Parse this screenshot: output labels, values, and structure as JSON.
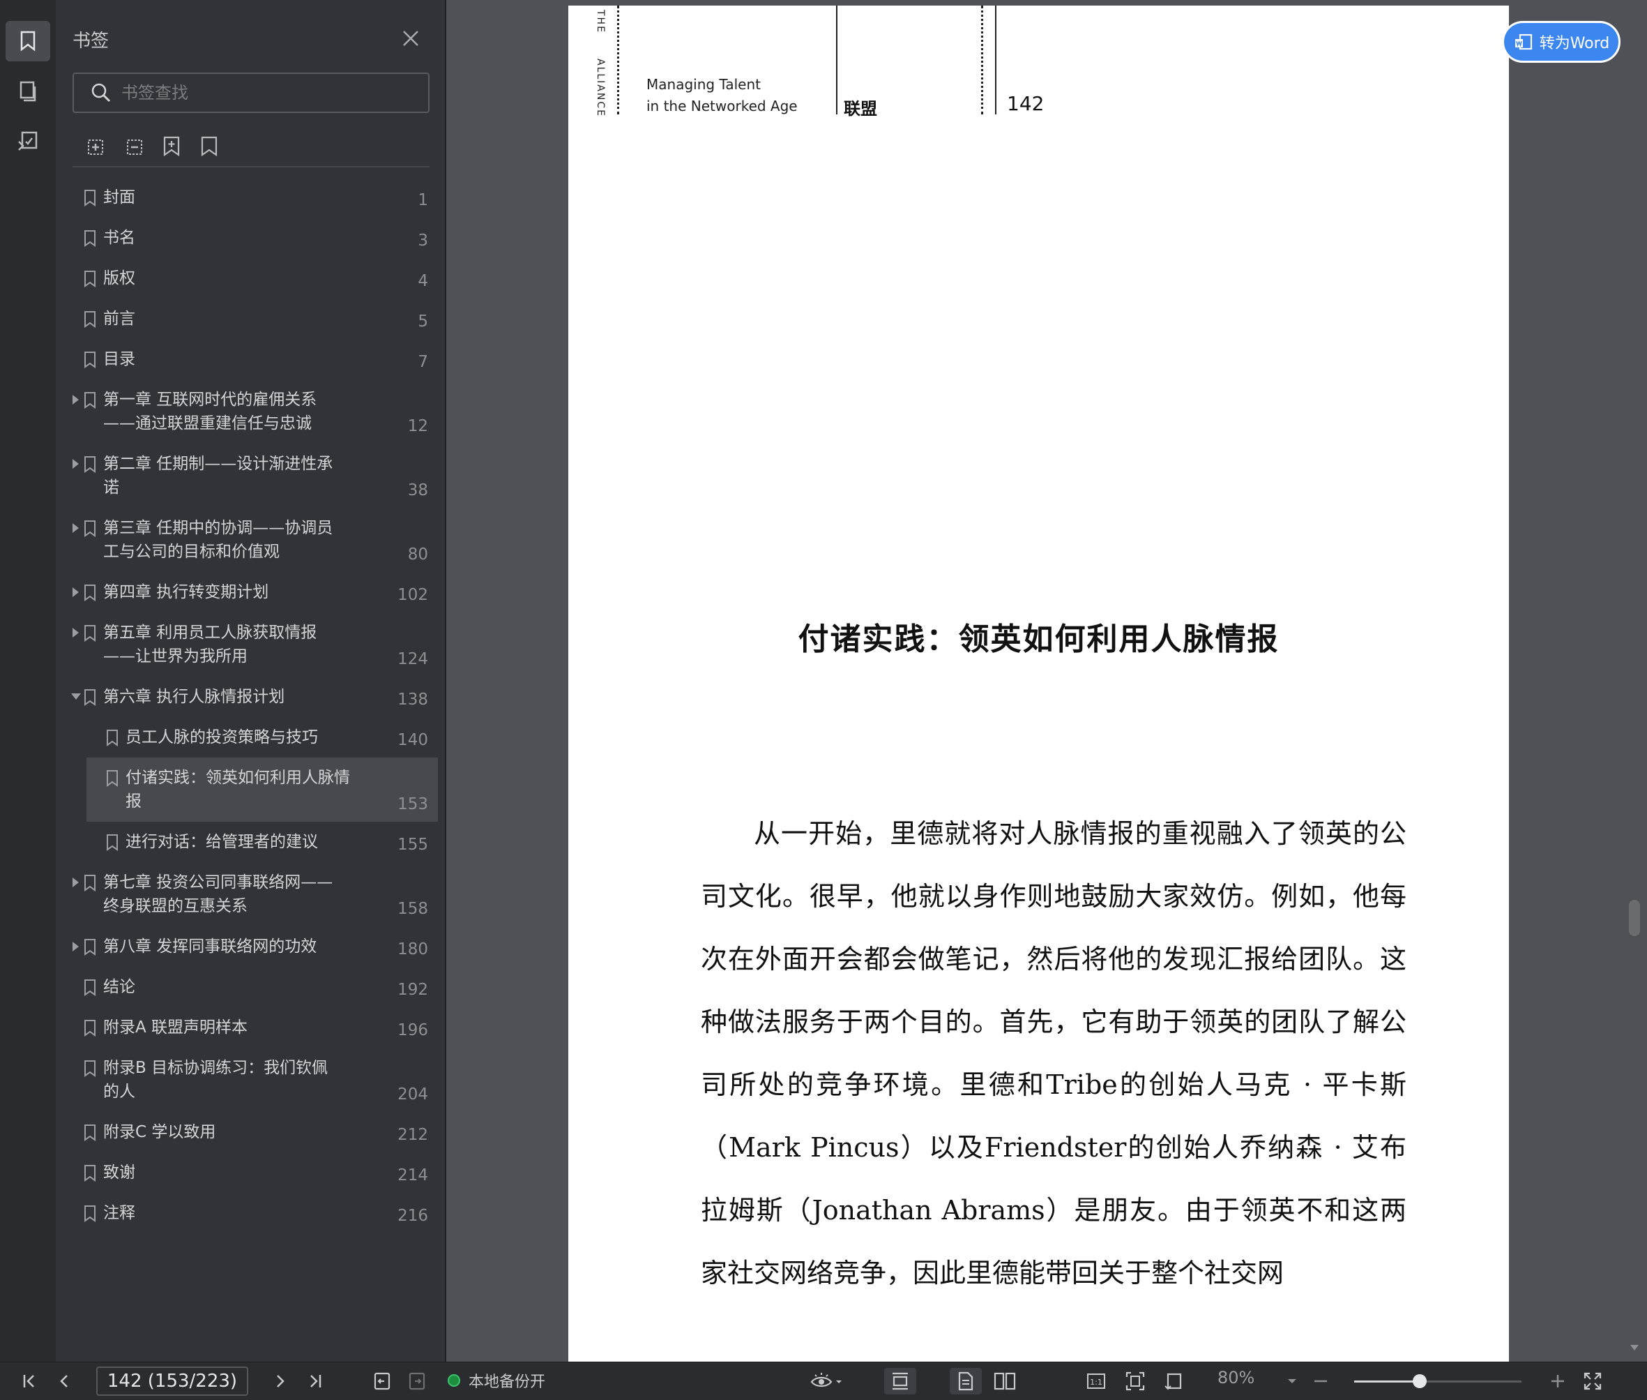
{
  "panel": {
    "title": "书签",
    "search_placeholder": "书签查找"
  },
  "bookmarks": [
    {
      "label": "封面",
      "page": "1",
      "level": 0,
      "expandable": false
    },
    {
      "label": "书名",
      "page": "3",
      "level": 0,
      "expandable": false
    },
    {
      "label": "版权",
      "page": "4",
      "level": 0,
      "expandable": false
    },
    {
      "label": "前言",
      "page": "5",
      "level": 0,
      "expandable": false
    },
    {
      "label": "目录",
      "page": "7",
      "level": 0,
      "expandable": false
    },
    {
      "label": "第一章 互联网时代的雇佣关系——通过联盟重建信任与忠诚",
      "page": "12",
      "level": 0,
      "expandable": true
    },
    {
      "label": "第二章 任期制——设计渐进性承诺",
      "page": "38",
      "level": 0,
      "expandable": true
    },
    {
      "label": "第三章 任期中的协调——协调员工与公司的目标和价值观",
      "page": "80",
      "level": 0,
      "expandable": true
    },
    {
      "label": "第四章 执行转变期计划",
      "page": "102",
      "level": 0,
      "expandable": true
    },
    {
      "label": "第五章 利用员工人脉获取情报——让世界为我所用",
      "page": "124",
      "level": 0,
      "expandable": true
    },
    {
      "label": "第六章 执行人脉情报计划",
      "page": "138",
      "level": 0,
      "expandable": true,
      "expanded": true
    },
    {
      "label": "员工人脉的投资策略与技巧",
      "page": "140",
      "level": 1,
      "expandable": false
    },
    {
      "label": "付诸实践：领英如何利用人脉情报",
      "page": "153",
      "level": 1,
      "expandable": false,
      "selected": true
    },
    {
      "label": "进行对话：给管理者的建议",
      "page": "155",
      "level": 1,
      "expandable": false
    },
    {
      "label": "第七章 投资公司同事联络网——终身联盟的互惠关系",
      "page": "158",
      "level": 0,
      "expandable": true
    },
    {
      "label": "第八章 发挥同事联络网的功效",
      "page": "180",
      "level": 0,
      "expandable": true
    },
    {
      "label": "结论",
      "page": "192",
      "level": 0,
      "expandable": false
    },
    {
      "label": "附录A 联盟声明样本",
      "page": "196",
      "level": 0,
      "expandable": false
    },
    {
      "label": "附录B 目标协调练习：我们钦佩的人",
      "page": "204",
      "level": 0,
      "expandable": false
    },
    {
      "label": "附录C 学以致用",
      "page": "212",
      "level": 0,
      "expandable": false
    },
    {
      "label": "致谢",
      "page": "214",
      "level": 0,
      "expandable": false
    },
    {
      "label": "注释",
      "page": "216",
      "level": 0,
      "expandable": false
    }
  ],
  "doc": {
    "header_vertical_1": "THE",
    "header_vertical_2": "ALLIANCE",
    "header_en_1": "Managing Talent",
    "header_en_2": "in the Networked Age",
    "header_cn": "联盟",
    "header_page": "142",
    "section_title": "付诸实践：领英如何利用人脉情报",
    "paragraph": "从一开始，里德就将对人脉情报的重视融入了领英的公司文化。很早，他就以身作则地鼓励大家效仿。例如，他每次在外面开会都会做笔记，然后将他的发现汇报给团队。这种做法服务于两个目的。首先，它有助于领英的团队了解公司所处的竞争环境。里德和Tribe的创始人马克 · 平卡斯（Mark Pincus）以及Friendster的创始人乔纳森 · 艾布拉姆斯（Jonathan Abrams）是朋友。由于领英不和这两家社交网络竞争，因此里德能带回关于整个社交网"
  },
  "convert_button": "转为Word",
  "statusbar": {
    "page_value": "142 (153/223)",
    "backup_label": "本地备份开",
    "zoom": "80%"
  },
  "colors": {
    "accent": "#3c86f0",
    "backup_dot": "#1d8d3f",
    "panel_bg": "#323338",
    "content_bg": "#505157"
  }
}
